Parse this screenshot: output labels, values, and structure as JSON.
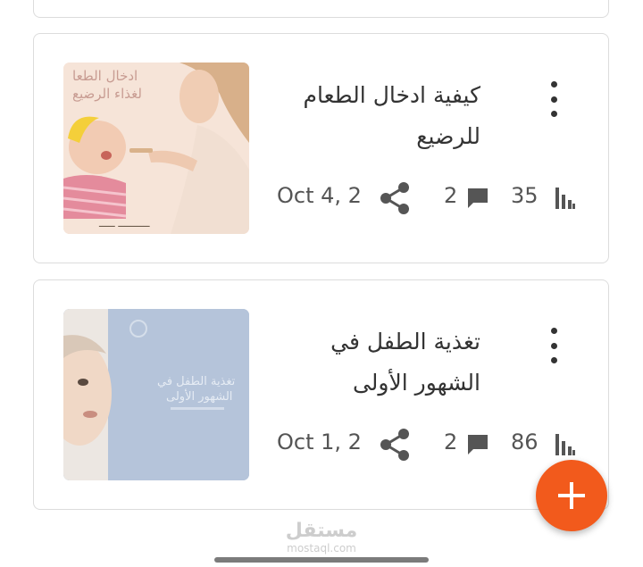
{
  "posts": [
    {
      "title": "كيفية ادخال الطعام للرضيع",
      "date": "Oct 4, 2",
      "comments": "2",
      "views": "35",
      "thumbnail_text": "ادخال الطعام لغذاء الرضيع"
    },
    {
      "title": "تغذية الطفل في الشهور الأولى",
      "date": "Oct 1, 2",
      "comments": "2",
      "views": "86",
      "thumbnail_text": "تغذية الطفل في الشهور الأولى"
    }
  ],
  "fab": {
    "icon": "plus-icon",
    "color": "#f25a1c"
  },
  "watermark": {
    "arabic": "مستقل",
    "latin": "mostaql.com"
  }
}
